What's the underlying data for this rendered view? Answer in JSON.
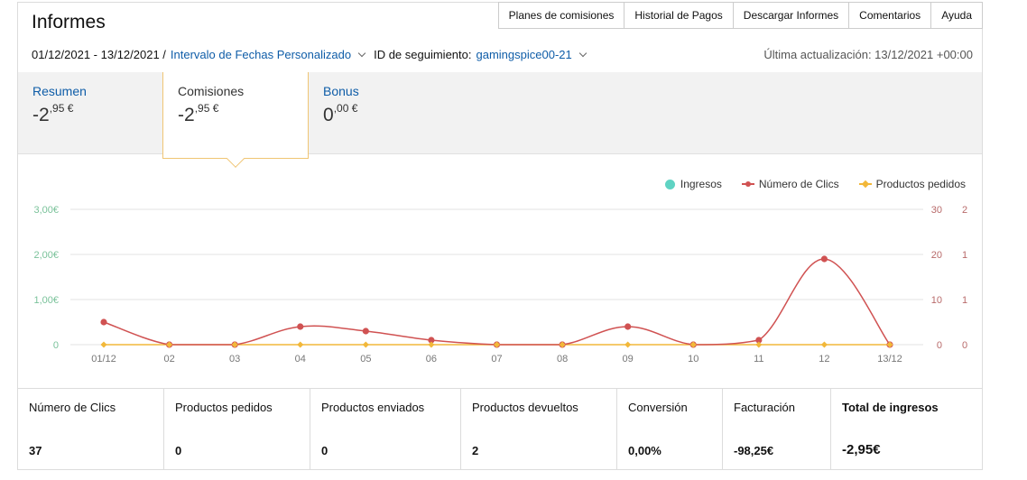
{
  "header": {
    "title": "Informes",
    "nav": [
      "Planes de comisiones",
      "Historial de Pagos",
      "Descargar Informes",
      "Comentarios",
      "Ayuda"
    ]
  },
  "filters": {
    "date_range": "01/12/2021 - 13/12/2021 /",
    "range_type": "Intervalo de Fechas Personalizado",
    "tracking_label": "ID de seguimiento:",
    "tracking_id": "gamingspice00-21",
    "updated": "Última actualización: 13/12/2021 +00:00"
  },
  "tabs": [
    {
      "label": "Resumen",
      "int": "-2",
      "dec": ",95 €"
    },
    {
      "label": "Comisiones",
      "int": "-2",
      "dec": ",95 €"
    },
    {
      "label": "Bonus",
      "int": "0",
      "dec": ",00 €"
    }
  ],
  "legend": [
    "Ingresos",
    "Número de Clics",
    "Productos pedidos"
  ],
  "chart_data": {
    "type": "line",
    "categories": [
      "01/12",
      "02",
      "03",
      "04",
      "05",
      "06",
      "07",
      "08",
      "09",
      "10",
      "11",
      "12",
      "13/12"
    ],
    "y_left_ticks": [
      "3,00€",
      "2,00€",
      "1,00€",
      "0"
    ],
    "y_right1_ticks": [
      "30",
      "20",
      "10",
      "0"
    ],
    "y_right2_ticks": [
      "2",
      "1",
      "1",
      "0"
    ],
    "ylim_left": [
      0,
      3
    ],
    "ylim_clicks": [
      0,
      30
    ],
    "series": [
      {
        "name": "Ingresos",
        "color": "#5fd3c3",
        "values": [
          0,
          0,
          0,
          0,
          0,
          0,
          0,
          0,
          0,
          0,
          0,
          0,
          0
        ]
      },
      {
        "name": "Número de Clics",
        "color": "#d05252",
        "values": [
          5,
          0,
          0,
          4,
          3,
          1,
          0,
          0,
          4,
          0,
          1,
          19,
          0
        ]
      },
      {
        "name": "Productos pedidos",
        "color": "#f2b83a",
        "values": [
          0,
          0,
          0,
          0,
          0,
          0,
          0,
          0,
          0,
          0,
          0,
          0,
          0
        ]
      }
    ],
    "colors": {
      "grid": "#e3e3e3",
      "left_axis": "#7ac29a",
      "right_axis": "#b86a6a",
      "axis_text": "#777777"
    }
  },
  "stats": [
    {
      "label": "Número de Clics",
      "value": "37"
    },
    {
      "label": "Productos pedidos",
      "value": "0"
    },
    {
      "label": "Productos enviados",
      "value": "0"
    },
    {
      "label": "Productos devueltos",
      "value": "2"
    },
    {
      "label": "Conversión",
      "value": "0,00%"
    },
    {
      "label": "Facturación",
      "value": "-98,25€"
    },
    {
      "label": "Total de ingresos",
      "value": "-2,95€"
    }
  ]
}
